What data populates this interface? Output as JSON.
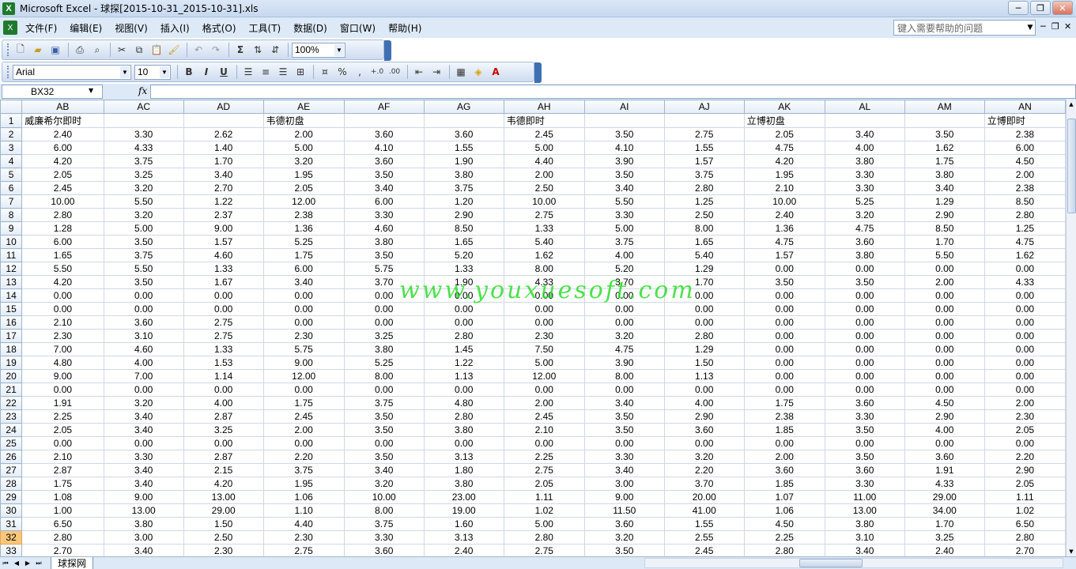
{
  "window": {
    "title": "Microsoft Excel - 球探[2015-10-31_2015-10-31].xls",
    "controls": [
      "─",
      "❐",
      "✕"
    ]
  },
  "menu": {
    "items": [
      "文件(F)",
      "编辑(E)",
      "视图(V)",
      "插入(I)",
      "格式(O)",
      "工具(T)",
      "数据(D)",
      "窗口(W)",
      "帮助(H)"
    ],
    "help_placeholder": "键入需要帮助的问题"
  },
  "toolbar": {
    "zoom": "100%",
    "font_name": "Arial",
    "font_size": "10"
  },
  "formula_bar": {
    "name_box": "BX32",
    "fx_label": "fx",
    "formula": ""
  },
  "sheet": {
    "columns": [
      "AB",
      "AC",
      "AD",
      "AE",
      "AF",
      "AG",
      "AH",
      "AI",
      "AJ",
      "AK",
      "AL",
      "AM",
      "AN"
    ],
    "active_row": 32,
    "header_row": [
      "威廉希尔即时",
      "",
      "",
      "韦德初盘",
      "",
      "",
      "韦德即时",
      "",
      "",
      "立博初盘",
      "",
      "",
      "立博即时"
    ],
    "rows": [
      {
        "n": 2,
        "v": [
          "2.40",
          "3.30",
          "2.62",
          "2.00",
          "3.60",
          "3.60",
          "2.45",
          "3.50",
          "2.75",
          "2.05",
          "3.40",
          "3.50",
          "2.38"
        ]
      },
      {
        "n": 3,
        "v": [
          "6.00",
          "4.33",
          "1.40",
          "5.00",
          "4.10",
          "1.55",
          "5.00",
          "4.10",
          "1.55",
          "4.75",
          "4.00",
          "1.62",
          "6.00"
        ]
      },
      {
        "n": 4,
        "v": [
          "4.20",
          "3.75",
          "1.70",
          "3.20",
          "3.60",
          "1.90",
          "4.40",
          "3.90",
          "1.57",
          "4.20",
          "3.80",
          "1.75",
          "4.50"
        ]
      },
      {
        "n": 5,
        "v": [
          "2.05",
          "3.25",
          "3.40",
          "1.95",
          "3.50",
          "3.80",
          "2.00",
          "3.50",
          "3.75",
          "1.95",
          "3.30",
          "3.80",
          "2.00"
        ]
      },
      {
        "n": 6,
        "v": [
          "2.45",
          "3.20",
          "2.70",
          "2.05",
          "3.40",
          "3.75",
          "2.50",
          "3.40",
          "2.80",
          "2.10",
          "3.30",
          "3.40",
          "2.38"
        ]
      },
      {
        "n": 7,
        "v": [
          "10.00",
          "5.50",
          "1.22",
          "12.00",
          "6.00",
          "1.20",
          "10.00",
          "5.50",
          "1.25",
          "10.00",
          "5.25",
          "1.29",
          "8.50"
        ]
      },
      {
        "n": 8,
        "v": [
          "2.80",
          "3.20",
          "2.37",
          "2.38",
          "3.30",
          "2.90",
          "2.75",
          "3.30",
          "2.50",
          "2.40",
          "3.20",
          "2.90",
          "2.80"
        ]
      },
      {
        "n": 9,
        "v": [
          "1.28",
          "5.00",
          "9.00",
          "1.36",
          "4.60",
          "8.50",
          "1.33",
          "5.00",
          "8.00",
          "1.36",
          "4.75",
          "8.50",
          "1.25"
        ]
      },
      {
        "n": 10,
        "v": [
          "6.00",
          "3.50",
          "1.57",
          "5.25",
          "3.80",
          "1.65",
          "5.40",
          "3.75",
          "1.65",
          "4.75",
          "3.60",
          "1.70",
          "4.75"
        ]
      },
      {
        "n": 11,
        "v": [
          "1.65",
          "3.75",
          "4.60",
          "1.75",
          "3.50",
          "5.20",
          "1.62",
          "4.00",
          "5.40",
          "1.57",
          "3.80",
          "5.50",
          "1.62"
        ]
      },
      {
        "n": 12,
        "v": [
          "5.50",
          "5.50",
          "1.33",
          "6.00",
          "5.75",
          "1.33",
          "8.00",
          "5.20",
          "1.29",
          "0.00",
          "0.00",
          "0.00",
          "0.00"
        ]
      },
      {
        "n": 13,
        "v": [
          "4.20",
          "3.50",
          "1.67",
          "3.40",
          "3.70",
          "1.90",
          "4.33",
          "3.70",
          "1.70",
          "3.50",
          "3.50",
          "2.00",
          "4.33"
        ]
      },
      {
        "n": 14,
        "v": [
          "0.00",
          "0.00",
          "0.00",
          "0.00",
          "0.00",
          "0.00",
          "0.00",
          "0.00",
          "0.00",
          "0.00",
          "0.00",
          "0.00",
          "0.00"
        ]
      },
      {
        "n": 15,
        "v": [
          "0.00",
          "0.00",
          "0.00",
          "0.00",
          "0.00",
          "0.00",
          "0.00",
          "0.00",
          "0.00",
          "0.00",
          "0.00",
          "0.00",
          "0.00"
        ]
      },
      {
        "n": 16,
        "v": [
          "2.10",
          "3.60",
          "2.75",
          "0.00",
          "0.00",
          "0.00",
          "0.00",
          "0.00",
          "0.00",
          "0.00",
          "0.00",
          "0.00",
          "0.00"
        ]
      },
      {
        "n": 17,
        "v": [
          "2.30",
          "3.10",
          "2.75",
          "2.30",
          "3.25",
          "2.80",
          "2.30",
          "3.20",
          "2.80",
          "0.00",
          "0.00",
          "0.00",
          "0.00"
        ]
      },
      {
        "n": 18,
        "v": [
          "7.00",
          "4.60",
          "1.33",
          "5.75",
          "3.80",
          "1.45",
          "7.50",
          "4.75",
          "1.29",
          "0.00",
          "0.00",
          "0.00",
          "0.00"
        ]
      },
      {
        "n": 19,
        "v": [
          "4.80",
          "4.00",
          "1.53",
          "9.00",
          "5.25",
          "1.22",
          "5.00",
          "3.90",
          "1.50",
          "0.00",
          "0.00",
          "0.00",
          "0.00"
        ]
      },
      {
        "n": 20,
        "v": [
          "9.00",
          "7.00",
          "1.14",
          "12.00",
          "8.00",
          "1.13",
          "12.00",
          "8.00",
          "1.13",
          "0.00",
          "0.00",
          "0.00",
          "0.00"
        ]
      },
      {
        "n": 21,
        "v": [
          "0.00",
          "0.00",
          "0.00",
          "0.00",
          "0.00",
          "0.00",
          "0.00",
          "0.00",
          "0.00",
          "0.00",
          "0.00",
          "0.00",
          "0.00"
        ]
      },
      {
        "n": 22,
        "v": [
          "1.91",
          "3.20",
          "4.00",
          "1.75",
          "3.75",
          "4.80",
          "2.00",
          "3.40",
          "4.00",
          "1.75",
          "3.60",
          "4.50",
          "2.00"
        ]
      },
      {
        "n": 23,
        "v": [
          "2.25",
          "3.40",
          "2.87",
          "2.45",
          "3.50",
          "2.80",
          "2.45",
          "3.50",
          "2.90",
          "2.38",
          "3.30",
          "2.90",
          "2.30"
        ]
      },
      {
        "n": 24,
        "v": [
          "2.05",
          "3.40",
          "3.25",
          "2.00",
          "3.50",
          "3.80",
          "2.10",
          "3.50",
          "3.60",
          "1.85",
          "3.50",
          "4.00",
          "2.05"
        ]
      },
      {
        "n": 25,
        "v": [
          "0.00",
          "0.00",
          "0.00",
          "0.00",
          "0.00",
          "0.00",
          "0.00",
          "0.00",
          "0.00",
          "0.00",
          "0.00",
          "0.00",
          "0.00"
        ]
      },
      {
        "n": 26,
        "v": [
          "2.10",
          "3.30",
          "2.87",
          "2.20",
          "3.50",
          "3.13",
          "2.25",
          "3.30",
          "3.20",
          "2.00",
          "3.50",
          "3.60",
          "2.20"
        ]
      },
      {
        "n": 27,
        "v": [
          "2.87",
          "3.40",
          "2.15",
          "3.75",
          "3.40",
          "1.80",
          "2.75",
          "3.40",
          "2.20",
          "3.60",
          "3.60",
          "1.91",
          "2.90"
        ]
      },
      {
        "n": 28,
        "v": [
          "1.75",
          "3.40",
          "4.20",
          "1.95",
          "3.20",
          "3.80",
          "2.05",
          "3.00",
          "3.70",
          "1.85",
          "3.30",
          "4.33",
          "2.05"
        ]
      },
      {
        "n": 29,
        "v": [
          "1.08",
          "9.00",
          "13.00",
          "1.06",
          "10.00",
          "23.00",
          "1.11",
          "9.00",
          "20.00",
          "1.07",
          "11.00",
          "29.00",
          "1.11"
        ]
      },
      {
        "n": 30,
        "v": [
          "1.00",
          "13.00",
          "29.00",
          "1.10",
          "8.00",
          "19.00",
          "1.02",
          "11.50",
          "41.00",
          "1.06",
          "13.00",
          "34.00",
          "1.02"
        ]
      },
      {
        "n": 31,
        "v": [
          "6.50",
          "3.80",
          "1.50",
          "4.40",
          "3.75",
          "1.60",
          "5.00",
          "3.60",
          "1.55",
          "4.50",
          "3.80",
          "1.70",
          "6.50"
        ]
      },
      {
        "n": 32,
        "v": [
          "2.80",
          "3.00",
          "2.50",
          "2.30",
          "3.30",
          "3.13",
          "2.80",
          "3.20",
          "2.55",
          "2.25",
          "3.10",
          "3.25",
          "2.80"
        ]
      },
      {
        "n": 33,
        "v": [
          "2.70",
          "3.40",
          "2.30",
          "2.75",
          "3.60",
          "2.40",
          "2.75",
          "3.50",
          "2.45",
          "2.80",
          "3.40",
          "2.40",
          "2.70"
        ]
      }
    ],
    "tab_name": "球探网"
  },
  "watermark": "www.youxuesoft.com"
}
